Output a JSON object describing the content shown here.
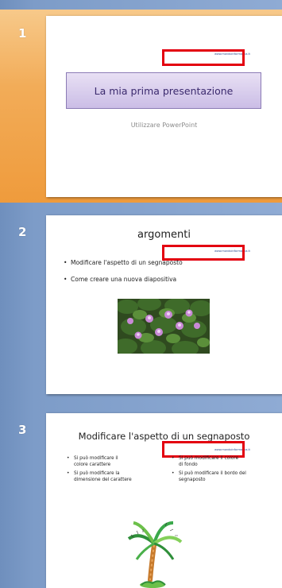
{
  "thumbnails": [
    {
      "number": "1",
      "selected": true,
      "url": "www.mondoinformatica.it",
      "title": "La mia prima presentazione",
      "subtitle": "Utilizzare PowerPoint"
    },
    {
      "number": "2",
      "selected": false,
      "url": "www.mondoinformatica.it",
      "title": "argomenti",
      "bullets": [
        "Modificare l'aspetto di un segnaposto",
        "Come creare una nuova diapositiva"
      ],
      "image_icon": "flowers-picture"
    },
    {
      "number": "3",
      "selected": false,
      "url": "www.mondoinformatica.it",
      "title": "Modificare l'aspetto di un segnaposto",
      "bullets_left": [
        "Si può modificare il colore carattere",
        "Si può modificare la dimensione del carattere"
      ],
      "bullets_right": [
        "Si può modificare il colore di fondo",
        "Si può modificare il bordo del segnaposto"
      ],
      "image_icon": "palm-tree-clipart"
    }
  ],
  "colors": {
    "selection": "#ef9b3c",
    "pane_background": "#7d9cc8",
    "highlight_box": "#e30010",
    "title_box": "#cbbde6"
  }
}
